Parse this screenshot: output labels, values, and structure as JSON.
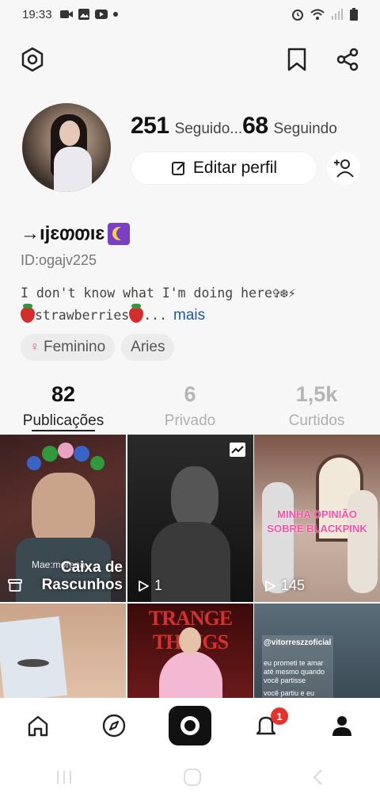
{
  "status_bar": {
    "time": "19:33"
  },
  "profile": {
    "followers_count": "251",
    "followers_label": "Seguido...",
    "following_count": "68",
    "following_label": "Seguindo",
    "edit_button_label": "Editar perfil",
    "username": "→ıjɛთთıɛ",
    "user_id": "ID:ogajv225",
    "bio_line1": "I don't know what I'm doing here✞❆⚡",
    "bio_line2": "strawberries",
    "bio_ellipsis": "...",
    "more_label": "mais",
    "tags": [
      "Feminino",
      "Aries"
    ]
  },
  "tabs": [
    {
      "count": "82",
      "label": "Publicações",
      "active": true
    },
    {
      "count": "6",
      "label": "Privado",
      "active": false
    },
    {
      "count": "1,5k",
      "label": "Curtidos",
      "active": false
    }
  ],
  "grid": {
    "cell1": {
      "title_line1": "Caixa de",
      "title_line2": "Rascunhos",
      "watermark": "Mae:morena"
    },
    "cell2": {
      "views": "1"
    },
    "cell3": {
      "views": "145",
      "caption_line1": "MINHA OPINIÃO",
      "caption_line2": "SOBRE BLACKPINK"
    },
    "cell4": {},
    "cell5": {
      "text": "TRANGE THINGS"
    },
    "cell6": {
      "handle": "@vitorresz​zoficial",
      "line1": "eu prometi te amar",
      "line2": "até mesmo quando",
      "line3": "você partisse",
      "line4": "você partiu e eu"
    }
  },
  "bottom_nav": {
    "notification_count": "1"
  },
  "colors": {
    "accent_text": "#1a5aa8",
    "badge": "#e5332b"
  }
}
